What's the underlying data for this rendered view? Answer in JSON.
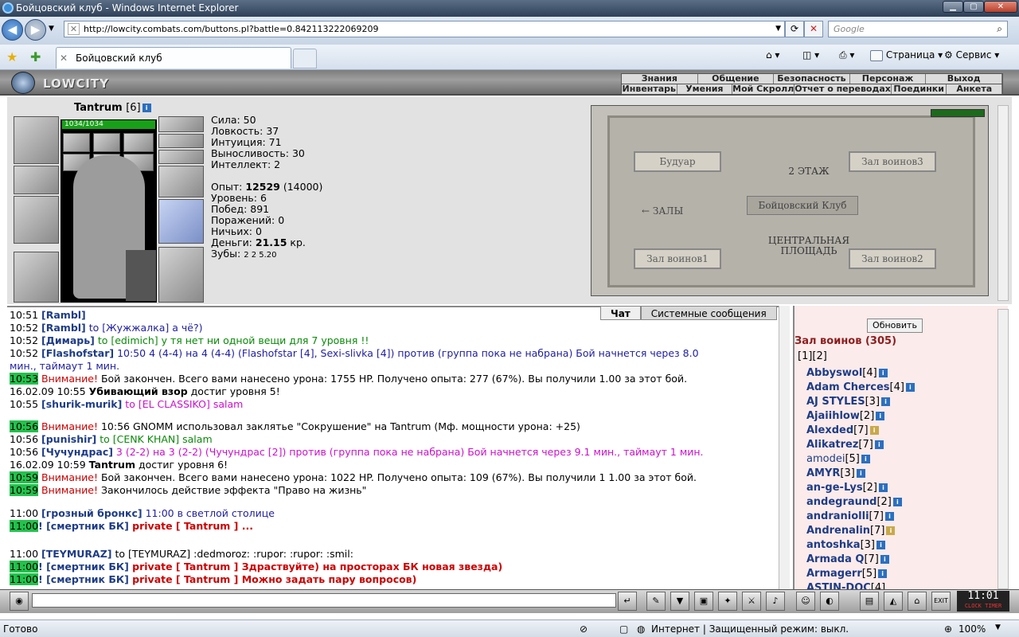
{
  "window": {
    "title": "Бойцовский клуб - Windows Internet Explorer"
  },
  "browser": {
    "url": "http://lowcity.combats.com/buttons.pl?battle=0.842113222069209",
    "search_placeholder": "Google",
    "tab_title": "Бойцовский клуб",
    "page_menu": "Страница",
    "tools_menu": "Сервис"
  },
  "game": {
    "logo": "LOWCITY",
    "menu_top": [
      "Знания",
      "Общение",
      "Безопасность",
      "Персонаж",
      "Выход"
    ],
    "menu_bottom": [
      "Инвентарь",
      "Умения",
      "Мой Скролл",
      "Отчет о переводах",
      "Поединки",
      "Анкета"
    ],
    "character": {
      "name": "Tantrum",
      "level": "[6]",
      "hp": "1034/1034"
    },
    "stats": {
      "strength": "Сила: 50",
      "agility": "Ловкость: 37",
      "intuition": "Интуиция: 71",
      "endurance": "Выносливость: 30",
      "intellect": "Интеллект: 2",
      "exp_label": "Опыт: ",
      "exp_value": "12529",
      "exp_next": " (14000)",
      "level": "Уровень: 6",
      "wins": "Побед: 891",
      "losses": "Поражений: 0",
      "draws": "Ничьих: 0",
      "money_label": "Деньги: ",
      "money_value": "21.15",
      "money_unit": " кр.",
      "teeth_label": "Зубы: ",
      "teeth_value": "2 2 5.20"
    },
    "map": {
      "boudoir": "Будуар",
      "hall3": "Зал воинов3",
      "floor": "2 ЭТАЖ",
      "club": "Бойцовский Клуб",
      "halls": "← ЗАЛЫ",
      "central": "ЦЕНТРАЛЬНАЯ ПЛОЩАДЬ",
      "hall1": "Зал воинов1",
      "hall2": "Зал воинов2"
    },
    "chat_tabs": {
      "chat": "Чат",
      "system": "Системные сообщения"
    },
    "chat": [
      {
        "t": "10:51",
        "nick": "[Rambl]",
        "msg": ""
      },
      {
        "t": "10:52",
        "nick": "[Rambl]",
        "msg": " to [Жужжалка] а чё?)"
      },
      {
        "t": "10:52",
        "nick": "[Димарь]",
        "msg": " to [edimich] у тя нет ни одной вещи для 7 уровня !!"
      },
      {
        "t": "10:52",
        "nick": "[Flashofstar]",
        "msg": " 10:50 4 (4-4) на 4 (4-4) (Flashofstar [4], Sexi-slivka [4]) против (группа пока не набрана) Бой начнется через 8.0"
      },
      {
        "t": "",
        "nick": "",
        "msg": "мин., таймаут 1 мин."
      },
      {
        "t": "10:53",
        "warn": "Внимание!",
        "msg": " Бой закончен. Всего вами нанесено урона: 1755 HP. Получено опыта: 277 (67%). Вы получили 1.00 за этот бой."
      },
      {
        "t": "16.02.09 10:55",
        "nick": "Убивающий взор",
        "msg": " достиг уровня 5!"
      },
      {
        "t": "10:55",
        "nick": "[shurik-murik]",
        "msg": " to [EL CLASSIKO] salam"
      },
      {
        "t": "10:56",
        "warn": "Внимание!",
        "msg": " 10:56 GNOMM использовал заклятье \"Сокрушение\" на Tantrum (Мф. мощности урона: +25)"
      },
      {
        "t": "10:56",
        "nick": "[punishir]",
        "msg": " to [CENK KHAN] salam"
      },
      {
        "t": "10:56",
        "nick": "[Чучундрас]",
        "msg": " 3 (2-2) на 3 (2-2) (Чучундрас [2]) против (группа пока не набрана) Бой начнется через 9.1 мин., таймаут 1 мин."
      },
      {
        "t": "16.02.09 10:59",
        "nick": "Tantrum",
        "msg": " достиг уровня 6!"
      },
      {
        "t": "10:59",
        "warn": "Внимание!",
        "msg": " Бой закончен. Всего вами нанесено урона: 1022 HP. Получено опыта: 109 (67%). Вы получили 1 1.00 за этот бой."
      },
      {
        "t": "10:59",
        "warn": "Внимание!",
        "msg": " Закончилось действие эффекта \"Право на жизнь\""
      },
      {
        "t": "11:00",
        "nick": "[грозный бронкс]",
        "msg": " 11:00 в светлой столице"
      },
      {
        "t": "11:00",
        "nick": "! [смертник БК]",
        "msg": " private [ Tantrum ] ..."
      },
      {
        "t": "11:00",
        "nick": "[TEYMURAZ]",
        "msg": " to [TEYMURAZ] :dedmoroz: :rupor: :rupor: :smil:"
      },
      {
        "t": "11:00",
        "nick": "! [смертник БК]",
        "msg": " private [ Tantrum ] Здраствуйте) на просторах БК новая звезда)"
      },
      {
        "t": "11:00",
        "nick": "! [смертник БК]",
        "msg": " private [ Tantrum ] Можно задать пару вопросов)"
      }
    ],
    "online": {
      "refresh": "Обновить",
      "room": "Зал воинов (305)",
      "pages": "[1][2]",
      "users": [
        {
          "n": "Abbyswol",
          "l": "[4]"
        },
        {
          "n": "Adam Cherces",
          "l": "[4]"
        },
        {
          "n": "AJ STYLES",
          "l": "[3]"
        },
        {
          "n": "Ajaiihlow",
          "l": "[2]"
        },
        {
          "n": "Alexded",
          "l": "[7]"
        },
        {
          "n": "Alikatrez",
          "l": "[7]"
        },
        {
          "n": "amodei",
          "l": "[5]"
        },
        {
          "n": "AMYR",
          "l": "[3]"
        },
        {
          "n": "an-ge-Lys",
          "l": "[2]"
        },
        {
          "n": "andegraund",
          "l": "[2]"
        },
        {
          "n": "andraniolli",
          "l": "[7]"
        },
        {
          "n": "Andrenalin",
          "l": "[7]"
        },
        {
          "n": "antoshka",
          "l": "[3]"
        },
        {
          "n": "Armada Q",
          "l": "[7]"
        },
        {
          "n": "Armagerr",
          "l": "[5]"
        },
        {
          "n": "ASTIN-DOC",
          "l": "[4]"
        }
      ]
    },
    "clock": {
      "time": "11:01",
      "sub": "CLOCK TIMER"
    }
  },
  "status": {
    "ready": "Готово",
    "zone": "Интернет | Защищенный режим: выкл.",
    "zoom": "100%"
  }
}
